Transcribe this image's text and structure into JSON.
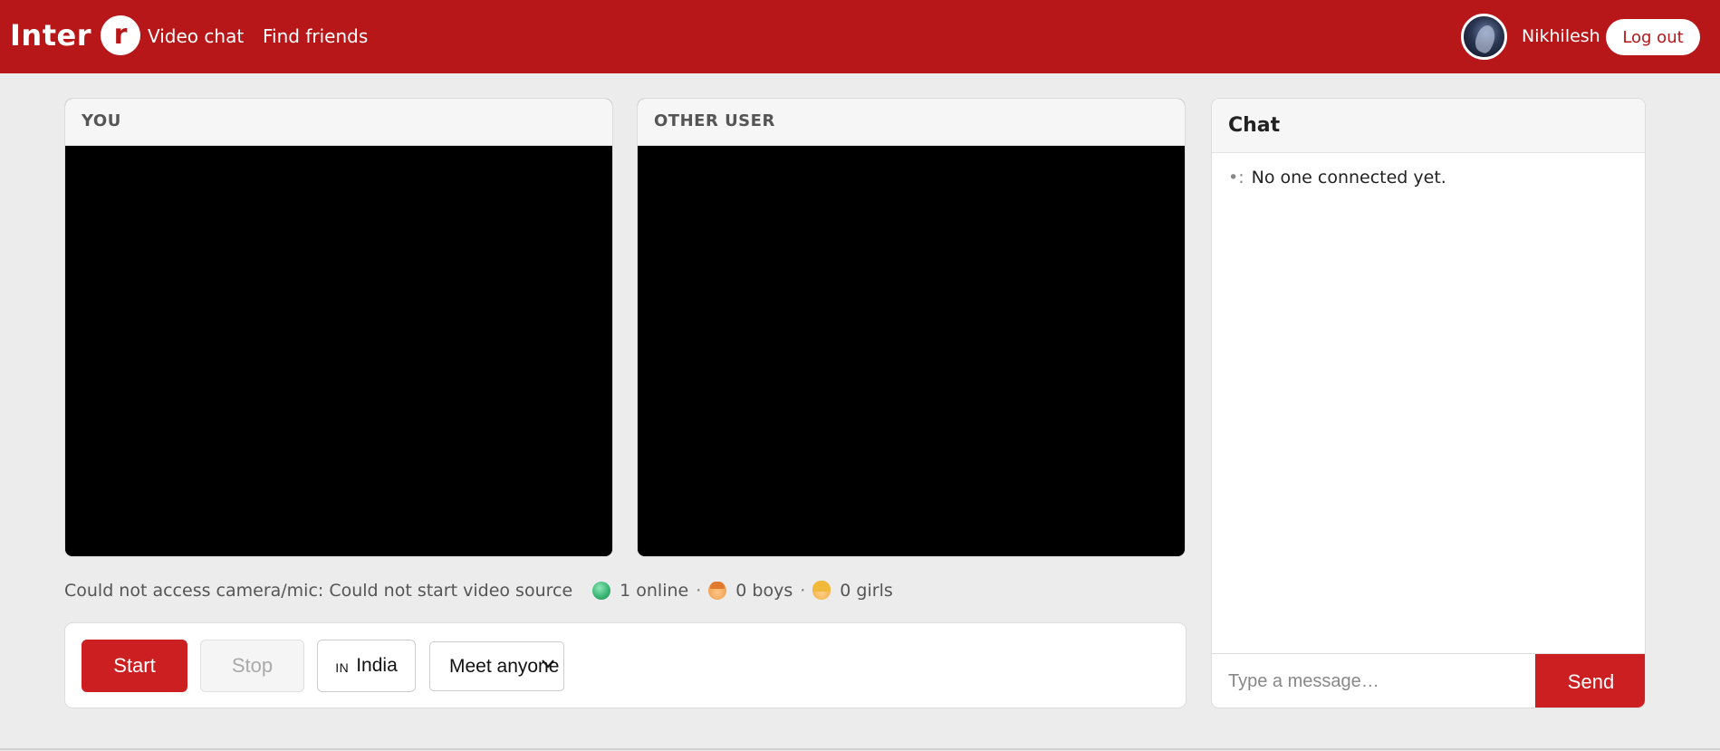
{
  "header": {
    "logo_text": "Inter",
    "logo_letter": "r",
    "nav": {
      "video_chat": "Video chat",
      "find_friends": "Find friends"
    },
    "user": {
      "name": "Nikhilesh",
      "logout_label": "Log out"
    },
    "colors": {
      "brand": "#b71719"
    }
  },
  "panels": {
    "you_title": "YOU",
    "other_title": "OTHER USER"
  },
  "status": {
    "error": "Could not access camera/mic: Could not start video source",
    "online": "1 online",
    "boys": "0 boys",
    "girls": "0 girls",
    "separator": "·"
  },
  "controls": {
    "start_label": "Start",
    "stop_label": "Stop",
    "country_flag": "IN",
    "country_label": "India",
    "meet_selected": "Meet anyone"
  },
  "chat": {
    "title": "Chat",
    "messages": [
      {
        "who": "•:",
        "text": "No one connected yet."
      }
    ],
    "input_placeholder": "Type a message…",
    "send_label": "Send"
  }
}
